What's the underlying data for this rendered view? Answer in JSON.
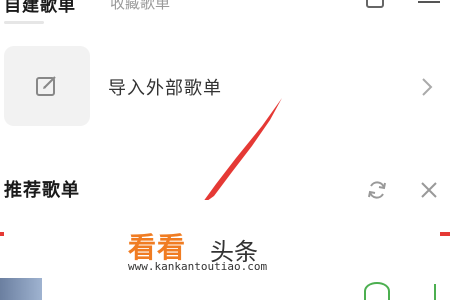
{
  "tabs": {
    "active": "自建歌单",
    "inactive": "收藏歌单"
  },
  "import": {
    "label": "导入外部歌单"
  },
  "recommend": {
    "title": "推荐歌单"
  },
  "watermark": {
    "logo_orange": "看看",
    "logo_dark": "头条",
    "url": "www.kankantoutiao.com"
  },
  "icons": {
    "edit": "edit-box-icon",
    "chevron": "chevron-right-icon",
    "refresh": "refresh-icon",
    "close": "close-icon",
    "add": "add-box-icon",
    "sort": "sort-list-icon"
  },
  "colors": {
    "accent_red": "#e53935",
    "watermark_orange": "#f07c22"
  }
}
